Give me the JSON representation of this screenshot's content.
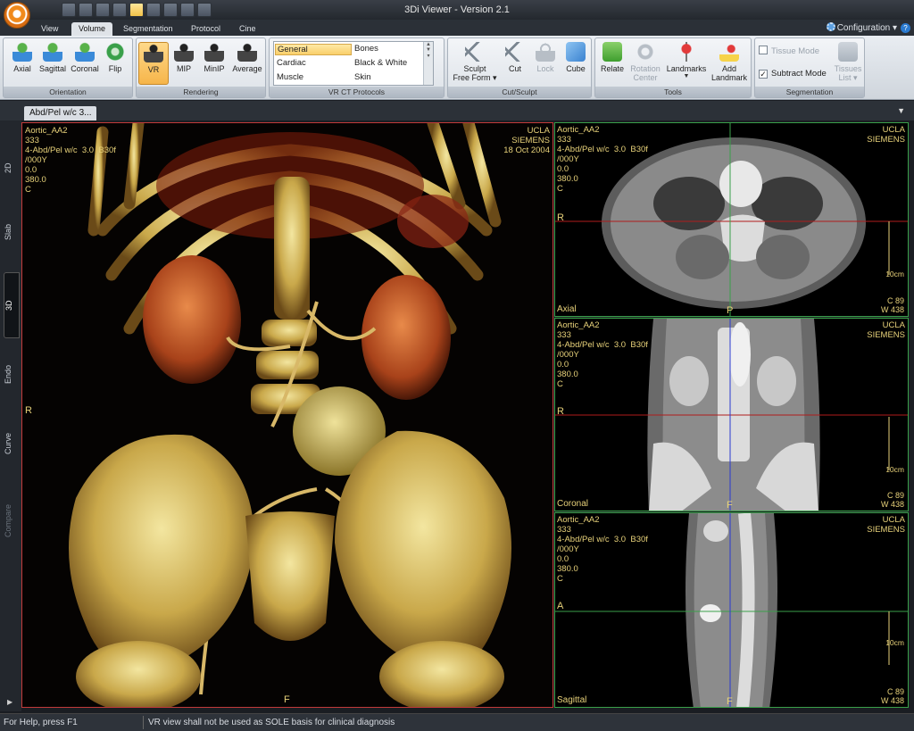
{
  "window": {
    "title": "3Di Viewer -  Version 2.1"
  },
  "ribbon_tabs": [
    {
      "label": "View"
    },
    {
      "label": "Volume"
    },
    {
      "label": "Segmentation"
    },
    {
      "label": "Protocol"
    },
    {
      "label": "Cine"
    }
  ],
  "active_tab": "Volume",
  "configuration": {
    "label": "Configuration"
  },
  "groups": {
    "orientation": {
      "label": "Orientation",
      "buttons": [
        "Axial",
        "Sagittal",
        "Coronal",
        "Flip"
      ]
    },
    "rendering": {
      "label": "Rendering",
      "buttons": [
        "VR",
        "MIP",
        "MinIP",
        "Average"
      ],
      "selected": "VR"
    },
    "protocols": {
      "label": "VR CT Protocols",
      "col1": [
        "General",
        "Cardiac",
        "Muscle"
      ],
      "col2": [
        "Bones",
        "Black & White",
        "Skin"
      ],
      "selected": "General"
    },
    "cut_sculpt": {
      "label": "Cut/Sculpt",
      "sculpt_line1": "Sculpt",
      "sculpt_line2": "Free Form",
      "cut": "Cut",
      "lock": "Lock",
      "cube": "Cube"
    },
    "tools": {
      "label": "Tools",
      "relate": "Relate",
      "rotation_line1": "Rotation",
      "rotation_line2": "Center",
      "landmarks": "Landmarks",
      "add_landmark_line1": "Add",
      "add_landmark_line2": "Landmark"
    },
    "segmentation": {
      "label": "Segmentation",
      "tissue_mode": "Tissue Mode",
      "subtract_mode": "Subtract Mode",
      "tissues_line1": "Tissues",
      "tissues_line2": "List"
    }
  },
  "doc_tab": {
    "label": "Abd/Pel w/c  3..."
  },
  "side_tabs": [
    "2D",
    "Slab",
    "3D",
    "Endo",
    "Curve",
    "Compare"
  ],
  "active_side_tab": "3D",
  "viewport_3d": {
    "info_left": "Aortic_AA2\n333\n4-Abd/Pel w/c  3.0  B30f\n/000Y\n0.0\n380.0\nC",
    "info_right": "UCLA\nSIEMENS\n18 Oct 2004",
    "left_orient": "R",
    "bottom_orient": "F"
  },
  "viewport_axial": {
    "info_left": "Aortic_AA2\n333\n4-Abd/Pel w/c  3.0  B30f\n/000Y\n0.0\n380.0\nC",
    "info_right": "UCLA\nSIEMENS",
    "name": "Axial",
    "left_orient": "R",
    "bottom_orient": "P",
    "scale": "10cm",
    "c_line": "C    89",
    "w_line": "W   438"
  },
  "viewport_coronal": {
    "info_left": "Aortic_AA2\n333\n4-Abd/Pel w/c  3.0  B30f\n/000Y\n0.0\n380.0\nC",
    "info_right": "UCLA\nSIEMENS",
    "name": "Coronal",
    "left_orient": "R",
    "bottom_orient": "F",
    "scale": "10cm",
    "c_line": "C    89",
    "w_line": "W   438"
  },
  "viewport_sagittal": {
    "info_left": "Aortic_AA2\n333\n4-Abd/Pel w/c  3.0  B30f\n/000Y\n0.0\n380.0\nC",
    "info_right": "UCLA\nSIEMENS",
    "name": "Sagittal",
    "left_orient": "A",
    "bottom_orient": "F",
    "scale": "10cm",
    "c_line": "C    89",
    "w_line": "W   438"
  },
  "status": {
    "help": "For Help, press F1",
    "message": "VR view shall not be used as SOLE basis for clinical diagnosis"
  },
  "colors": {
    "overlay_text": "#e8d27a",
    "vr_border": "#c23a3a",
    "mpr_border": "#3aa04a",
    "accent": "#f6b54a"
  }
}
